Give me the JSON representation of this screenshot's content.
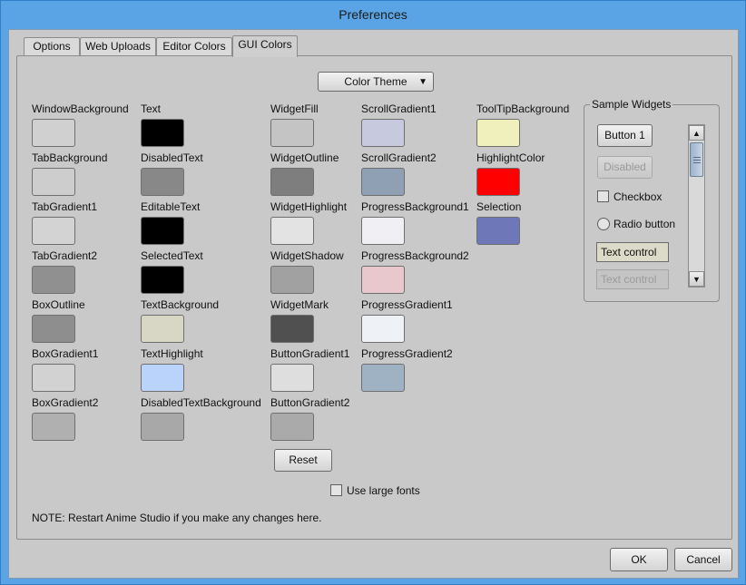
{
  "window": {
    "title": "Preferences"
  },
  "tabs": [
    {
      "label": "Options",
      "active": false
    },
    {
      "label": "Web Uploads",
      "active": false
    },
    {
      "label": "Editor Colors",
      "active": false
    },
    {
      "label": "GUI Colors",
      "active": true
    }
  ],
  "color_theme_label": "Color Theme",
  "colors": [
    {
      "label": "WindowBackground",
      "color": "#d0d0d0"
    },
    {
      "label": "TabBackground",
      "color": "#cdcdcd"
    },
    {
      "label": "TabGradient1",
      "color": "#d3d3d3"
    },
    {
      "label": "TabGradient2",
      "color": "#909090"
    },
    {
      "label": "BoxOutline",
      "color": "#8e8e8e"
    },
    {
      "label": "BoxGradient1",
      "color": "#d2d2d2"
    },
    {
      "label": "BoxGradient2",
      "color": "#b0b0b0"
    },
    {
      "label": "Text",
      "color": "#000000"
    },
    {
      "label": "DisabledText",
      "color": "#888888"
    },
    {
      "label": "EditableText",
      "color": "#000000"
    },
    {
      "label": "SelectedText",
      "color": "#000000"
    },
    {
      "label": "TextBackground",
      "color": "#d8d7c5"
    },
    {
      "label": "TextHighlight",
      "color": "#b9d3fb"
    },
    {
      "label": "DisabledTextBackground",
      "color": "#a8a8a8"
    },
    {
      "label": "WidgetFill",
      "color": "#c4c4c4"
    },
    {
      "label": "WidgetOutline",
      "color": "#7e7e7e"
    },
    {
      "label": "WidgetHighlight",
      "color": "#e3e3e3"
    },
    {
      "label": "WidgetShadow",
      "color": "#a1a1a1"
    },
    {
      "label": "WidgetMark",
      "color": "#505050"
    },
    {
      "label": "ButtonGradient1",
      "color": "#dedede"
    },
    {
      "label": "ButtonGradient2",
      "color": "#aaaaaa"
    },
    {
      "label": "ScrollGradient1",
      "color": "#c7cade"
    },
    {
      "label": "ScrollGradient2",
      "color": "#8f9fb4"
    },
    {
      "label": "ProgressBackground1",
      "color": "#f0f0f4"
    },
    {
      "label": "ProgressBackground2",
      "color": "#e8c8cc"
    },
    {
      "label": "ProgressGradient1",
      "color": "#eef1f5"
    },
    {
      "label": "ProgressGradient2",
      "color": "#9fb2c3"
    },
    {
      "label": "ToolTipBackground",
      "color": "#f0f0bd"
    },
    {
      "label": "HighlightColor",
      "color": "#ff0000"
    },
    {
      "label": "Selection",
      "color": "#6e78b8"
    }
  ],
  "sample_widgets": {
    "title": "Sample Widgets",
    "button1": "Button 1",
    "disabled": "Disabled",
    "checkbox": "Checkbox",
    "radio": "Radio button",
    "text_control": "Text control",
    "text_control_disabled": "Text control"
  },
  "reset_label": "Reset",
  "use_large_fonts_label": "Use large fonts",
  "note": "NOTE: Restart Anime Studio if you make any changes here.",
  "ok_label": "OK",
  "cancel_label": "Cancel"
}
